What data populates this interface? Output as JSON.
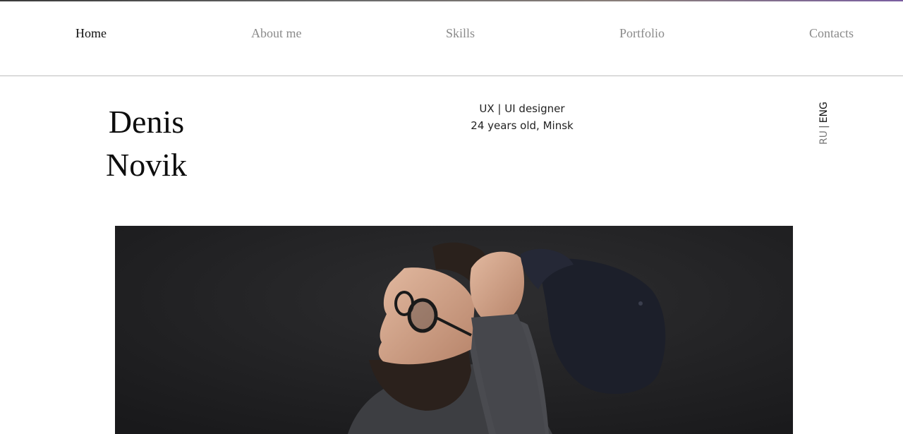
{
  "nav": {
    "items": [
      {
        "label": "Home",
        "active": true
      },
      {
        "label": "About me",
        "active": false
      },
      {
        "label": "Skills",
        "active": false
      },
      {
        "label": "Portfolio",
        "active": false
      },
      {
        "label": "Contacts",
        "active": false
      }
    ]
  },
  "hero": {
    "first_name": "Denis",
    "last_name": "Novik",
    "role": "UX | UI designer",
    "details": "24 years old, Minsk"
  },
  "language": {
    "options": [
      "RU",
      "ENG"
    ],
    "separator": "|",
    "selected": "ENG"
  },
  "colors": {
    "active_nav": "#111111",
    "inactive_nav": "#8a8a8a",
    "divider": "#bdbdbd",
    "photo_bg": "#232325"
  }
}
